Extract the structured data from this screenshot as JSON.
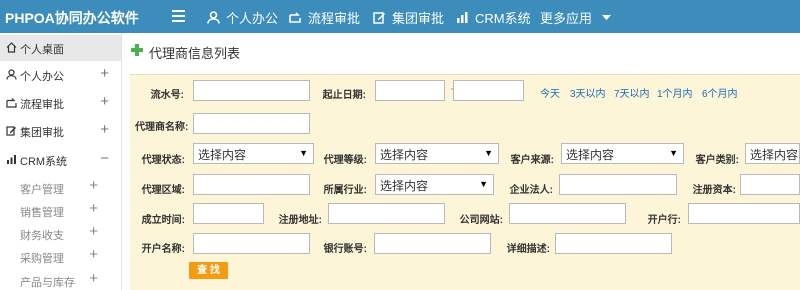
{
  "app": {
    "title": "PHPOA协同办公软件"
  },
  "topnav": [
    {
      "label": "个人办公",
      "icon": "user-icon"
    },
    {
      "label": "流程审批",
      "icon": "workflow-icon"
    },
    {
      "label": "集团审批",
      "icon": "edit-icon"
    },
    {
      "label": "CRM系统",
      "icon": "bar-chart-icon"
    },
    {
      "label": "更多应用",
      "icon": "caret-down-icon"
    }
  ],
  "sidebar": {
    "items": [
      {
        "label": "个人桌面",
        "icon": "home-icon",
        "toggle": ""
      },
      {
        "label": "个人办公",
        "icon": "user-icon",
        "toggle": "+"
      },
      {
        "label": "流程审批",
        "icon": "workflow-icon",
        "toggle": "+"
      },
      {
        "label": "集团审批",
        "icon": "edit-icon",
        "toggle": "+"
      },
      {
        "label": "CRM系统",
        "icon": "bar-chart-icon",
        "toggle": "−"
      }
    ],
    "subitems": [
      {
        "label": "客户管理",
        "toggle": "+"
      },
      {
        "label": "销售管理",
        "toggle": "+"
      },
      {
        "label": "财务收支",
        "toggle": "+"
      },
      {
        "label": "采购管理",
        "toggle": "+"
      },
      {
        "label": "产品与库存",
        "toggle": "+"
      }
    ]
  },
  "page": {
    "title": "代理商信息列表"
  },
  "form": {
    "serial_label": "流水号:",
    "date_label": "起止日期:",
    "date_sep": "-",
    "quick": [
      "今天",
      "3天以内",
      "7天以内",
      "1个月内",
      "6个月内"
    ],
    "name_label": "代理商名称:",
    "status_label": "代理状态:",
    "level_label": "代理等级:",
    "source_label": "客户来源:",
    "type_label": "客户类别:",
    "select_placeholder": "选择内容",
    "region_label": "代理区域:",
    "industry_label": "所属行业:",
    "legal_label": "企业法人:",
    "capital_label": "注册资本:",
    "founded_label": "成立时间:",
    "address_label": "注册地址:",
    "website_label": "公司网站:",
    "bank_label": "开户行:",
    "account_name_label": "开户名称:",
    "bank_account_label": "银行账号:",
    "desc_label": "详细描述:",
    "search_label": "查 找"
  }
}
